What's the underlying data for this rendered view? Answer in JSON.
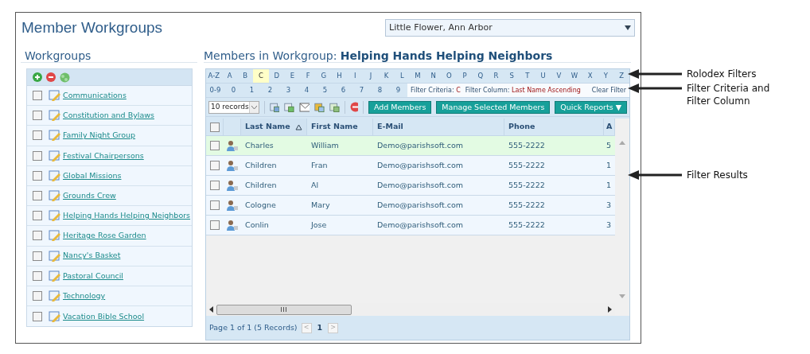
{
  "title": "Member Workgroups",
  "location_select": {
    "value": "Little Flower, Ann Arbor"
  },
  "workgroups": {
    "title": "Workgroups",
    "items": [
      {
        "label": "Communications",
        "checked": false
      },
      {
        "label": "Constitution and Bylaws",
        "checked": false
      },
      {
        "label": "Family Night Group",
        "checked": false
      },
      {
        "label": "Festival Chairpersons",
        "checked": false
      },
      {
        "label": "Global Missions",
        "checked": false
      },
      {
        "label": "Grounds Crew",
        "checked": false
      },
      {
        "label": "Helping Hands Helping Neighbors",
        "checked": false
      },
      {
        "label": "Heritage Rose Garden",
        "checked": false
      },
      {
        "label": "Nancy's Basket",
        "checked": false
      },
      {
        "label": "Pastoral Council",
        "checked": false
      },
      {
        "label": "Technology",
        "checked": false
      },
      {
        "label": "Vacation Bible School",
        "checked": false
      }
    ]
  },
  "members": {
    "title": "Members in Workgroup:",
    "workgroup": "Helping Hands Helping Neighbors",
    "rolodex_letters": [
      {
        "label": "A-Z",
        "selected": false
      },
      {
        "label": "A",
        "selected": false
      },
      {
        "label": "B",
        "selected": false
      },
      {
        "label": "C",
        "selected": true
      },
      {
        "label": "D",
        "selected": false
      },
      {
        "label": "E",
        "selected": false
      },
      {
        "label": "F",
        "selected": false
      },
      {
        "label": "G",
        "selected": false
      },
      {
        "label": "H",
        "selected": false
      },
      {
        "label": "I",
        "selected": false
      },
      {
        "label": "J",
        "selected": false
      },
      {
        "label": "K",
        "selected": false
      },
      {
        "label": "L",
        "selected": false
      },
      {
        "label": "M",
        "selected": false
      },
      {
        "label": "N",
        "selected": false
      },
      {
        "label": "O",
        "selected": false
      },
      {
        "label": "P",
        "selected": false
      },
      {
        "label": "Q",
        "selected": false
      },
      {
        "label": "R",
        "selected": false
      },
      {
        "label": "S",
        "selected": false
      },
      {
        "label": "T",
        "selected": false
      },
      {
        "label": "U",
        "selected": false
      },
      {
        "label": "V",
        "selected": false
      },
      {
        "label": "W",
        "selected": false
      },
      {
        "label": "X",
        "selected": false
      },
      {
        "label": "Y",
        "selected": false
      },
      {
        "label": "Z",
        "selected": false
      }
    ],
    "rolodex_digits": [
      {
        "label": "0-9",
        "selected": false
      },
      {
        "label": "0",
        "selected": false
      },
      {
        "label": "1",
        "selected": false
      },
      {
        "label": "2",
        "selected": false
      },
      {
        "label": "3",
        "selected": false
      },
      {
        "label": "4",
        "selected": false
      },
      {
        "label": "5",
        "selected": false
      },
      {
        "label": "6",
        "selected": false
      },
      {
        "label": "7",
        "selected": false
      },
      {
        "label": "8",
        "selected": false
      },
      {
        "label": "9",
        "selected": false
      }
    ],
    "filter_criteria": {
      "label": "Filter Criteria:",
      "value": "C"
    },
    "filter_column": {
      "label": "Filter Column:",
      "value": "Last Name Ascending"
    },
    "clear_filter": "Clear Filter",
    "page_size": "10 records",
    "buttons": [
      "Add Members",
      "Manage Selected Members"
    ],
    "quick_reports": "Quick Reports ▼",
    "table": {
      "select_all_checked": false,
      "columns": [
        {
          "label": "Last Name",
          "sorted": true
        },
        {
          "label": "First Name",
          "sorted": false
        },
        {
          "label": "E-Mail",
          "sorted": false
        },
        {
          "label": "Phone",
          "sorted": false
        },
        {
          "label": "A",
          "sorted": false
        }
      ],
      "rows": [
        {
          "selected": true,
          "checked": false,
          "cells": [
            "Charles",
            "William",
            "Demo@parishsoft.com",
            "555-2222",
            "5"
          ]
        },
        {
          "selected": false,
          "checked": false,
          "cells": [
            "Children",
            "Fran",
            "Demo@parishsoft.com",
            "555-2222",
            "1"
          ]
        },
        {
          "selected": false,
          "checked": false,
          "cells": [
            "Children",
            "Al",
            "Demo@parishsoft.com",
            "555-2222",
            "1"
          ]
        },
        {
          "selected": false,
          "checked": false,
          "cells": [
            "Cologne",
            "Mary",
            "Demo@parishsoft.com",
            "555-2222",
            "3"
          ]
        },
        {
          "selected": false,
          "checked": false,
          "cells": [
            "Conlin",
            "Jose",
            "Demo@parishsoft.com",
            "555-2222",
            "3"
          ]
        }
      ]
    },
    "pager": {
      "summary": "Page 1 of 1 (5 Records)",
      "prev": "<",
      "page": "1",
      "next": ">"
    }
  },
  "annotations": [
    {
      "text": "Rolodex Filters"
    },
    {
      "text": "Filter Criteria and Filter Column"
    },
    {
      "text": "Filter Results"
    }
  ]
}
